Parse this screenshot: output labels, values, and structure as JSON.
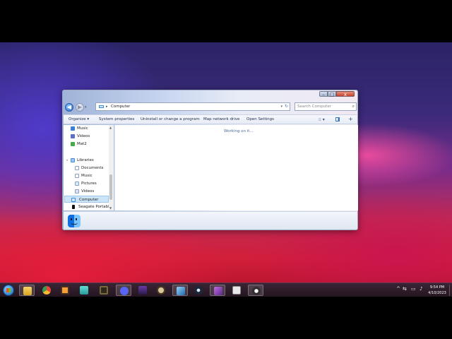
{
  "window": {
    "caption": {
      "minimize": "–",
      "maximize": "□",
      "close": "x"
    },
    "nav": {
      "back": "◀",
      "forward": "▶",
      "recent": "▾"
    },
    "address": {
      "separator": "▸",
      "path": "Computer",
      "dropdown": "▾",
      "refresh": "↻"
    },
    "search": {
      "placeholder": "Search Computer",
      "icon": "search-icon"
    },
    "toolbar": {
      "items": [
        "Organize ▾",
        "System properties",
        "Uninstall or change a program",
        "Map network drive",
        "Open Settings"
      ],
      "views": "⁝⁝ ▾",
      "help": "+"
    },
    "navpane": {
      "quick": [
        {
          "label": "Music",
          "icon": "music-icon",
          "pin": "✎"
        },
        {
          "label": "Videos",
          "icon": "videos-icon",
          "pin": "✎"
        },
        {
          "label": "Mat2",
          "icon": "folder-icon",
          "pin": "✎"
        }
      ],
      "libraries": {
        "label": "Libraries",
        "items": [
          "Documents",
          "Music",
          "Pictures",
          "Videos"
        ]
      },
      "computer": "Computer",
      "portable": "Seagate Portable"
    },
    "content": {
      "status": "Working on it..."
    }
  },
  "taskbar": {
    "apps": [
      "start",
      "file-explorer",
      "chrome",
      "media-player",
      "miku",
      "minecraft",
      "discord",
      "character",
      "game",
      "virtualbox",
      "steam",
      "minecraft-pickaxe",
      "mod-loader",
      "obs"
    ],
    "tray": {
      "arrow": "^",
      "time": "9:54 PM",
      "date": "4/10/2023"
    }
  },
  "colors": {
    "accent": "#3b8ad6",
    "selection": "#cce4f7",
    "taskbar": "#2f1d2b"
  }
}
